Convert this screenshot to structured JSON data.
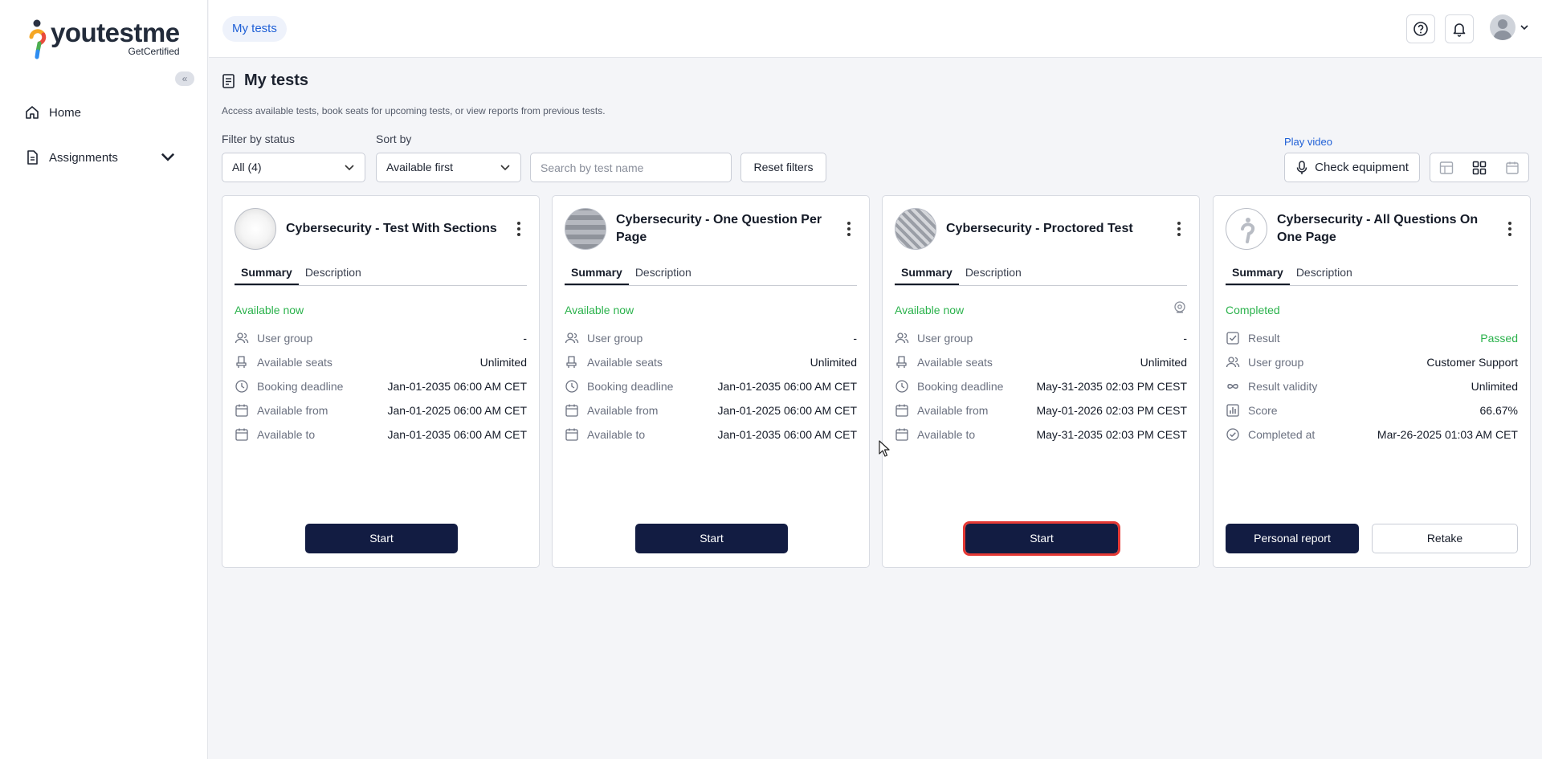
{
  "brand": {
    "name": "youtestme",
    "subtitle": "GetCertified"
  },
  "sidebar": {
    "collapse_label": "«",
    "items": [
      {
        "label": "Home",
        "icon": "home-icon"
      },
      {
        "label": "Assignments",
        "icon": "document-icon"
      }
    ]
  },
  "topbar": {
    "breadcrumb": "My tests"
  },
  "page": {
    "title": "My tests",
    "description": "Access available tests, book seats for upcoming tests, or view reports from previous tests."
  },
  "filters": {
    "status_label": "Filter by status",
    "status_value": "All (4)",
    "sort_label": "Sort by",
    "sort_value": "Available first",
    "search_placeholder": "Search by test name",
    "reset_label": "Reset filters",
    "play_video": "Play video",
    "check_equipment": "Check equipment"
  },
  "cards": [
    {
      "title": "Cybersecurity - Test With Sections",
      "tabs": [
        "Summary",
        "Description"
      ],
      "status": "Available now",
      "rows": [
        {
          "label": "User group",
          "value": "-"
        },
        {
          "label": "Available seats",
          "value": "Unlimited"
        },
        {
          "label": "Booking deadline",
          "value": "Jan-01-2035 06:00 AM CET"
        },
        {
          "label": "Available from",
          "value": "Jan-01-2025 06:00 AM CET"
        },
        {
          "label": "Available to",
          "value": "Jan-01-2035 06:00 AM CET"
        }
      ],
      "button": "Start"
    },
    {
      "title": "Cybersecurity - One Question Per Page",
      "tabs": [
        "Summary",
        "Description"
      ],
      "status": "Available now",
      "rows": [
        {
          "label": "User group",
          "value": "-"
        },
        {
          "label": "Available seats",
          "value": "Unlimited"
        },
        {
          "label": "Booking deadline",
          "value": "Jan-01-2035 06:00 AM CET"
        },
        {
          "label": "Available from",
          "value": "Jan-01-2025 06:00 AM CET"
        },
        {
          "label": "Available to",
          "value": "Jan-01-2035 06:00 AM CET"
        }
      ],
      "button": "Start"
    },
    {
      "title": "Cybersecurity - Proctored Test",
      "tabs": [
        "Summary",
        "Description"
      ],
      "status": "Available now",
      "rows": [
        {
          "label": "User group",
          "value": "-"
        },
        {
          "label": "Available seats",
          "value": "Unlimited"
        },
        {
          "label": "Booking deadline",
          "value": "May-31-2035 02:03 PM CEST"
        },
        {
          "label": "Available from",
          "value": "May-01-2026 02:03 PM CEST"
        },
        {
          "label": "Available to",
          "value": "May-31-2035 02:03 PM CEST"
        }
      ],
      "button": "Start"
    },
    {
      "title": "Cybersecurity - All Questions On One Page",
      "tabs": [
        "Summary",
        "Description"
      ],
      "status": "Completed",
      "rows": [
        {
          "label": "Result",
          "value": "Passed"
        },
        {
          "label": "User group",
          "value": "Customer Support"
        },
        {
          "label": "Result validity",
          "value": "Unlimited"
        },
        {
          "label": "Score",
          "value": "66.67%"
        },
        {
          "label": "Completed at",
          "value": "Mar-26-2025 01:03 AM CET"
        }
      ],
      "button": "Personal report",
      "button2": "Retake"
    }
  ],
  "colors": {
    "accent": "#121c42",
    "link": "#1e5fd6",
    "success": "#2bb24c",
    "focus": "#e53935"
  }
}
